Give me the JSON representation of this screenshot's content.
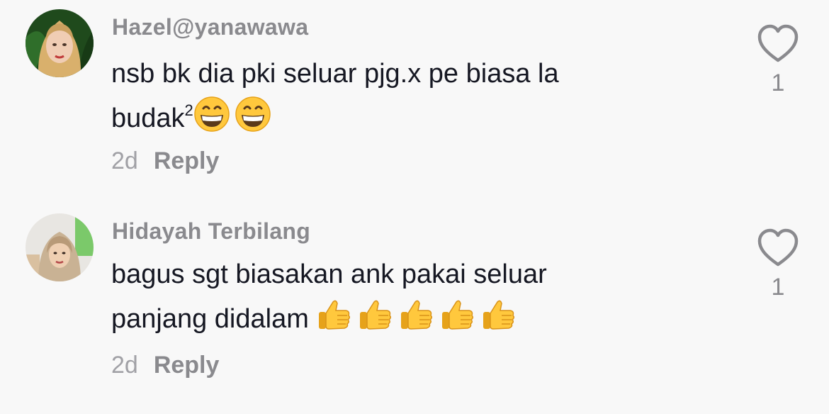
{
  "comments": [
    {
      "username": "Hazel@yanawawa",
      "text_line1": "nsb bk dia pki seluar pjg.x pe biasa la",
      "text_line2": "budak",
      "text_line2_sup": "2",
      "emojis": [
        "grinning-face-icon",
        "grinning-face-icon"
      ],
      "time": "2d",
      "reply_label": "Reply",
      "like_count": "1"
    },
    {
      "username": "Hidayah Terbilang",
      "text_line1": "bagus sgt biasakan ank pakai seluar",
      "text_line2": "panjang didalam",
      "emojis": [
        "thumbs-up-icon",
        "thumbs-up-icon",
        "thumbs-up-icon",
        "thumbs-up-icon",
        "thumbs-up-icon"
      ],
      "time": "2d",
      "reply_label": "Reply",
      "like_count": "1"
    }
  ],
  "colors": {
    "background": "#f8f8f8",
    "text": "#161823",
    "secondary": "#8a8a8e",
    "emoji_yellow": "#ffc83d"
  }
}
